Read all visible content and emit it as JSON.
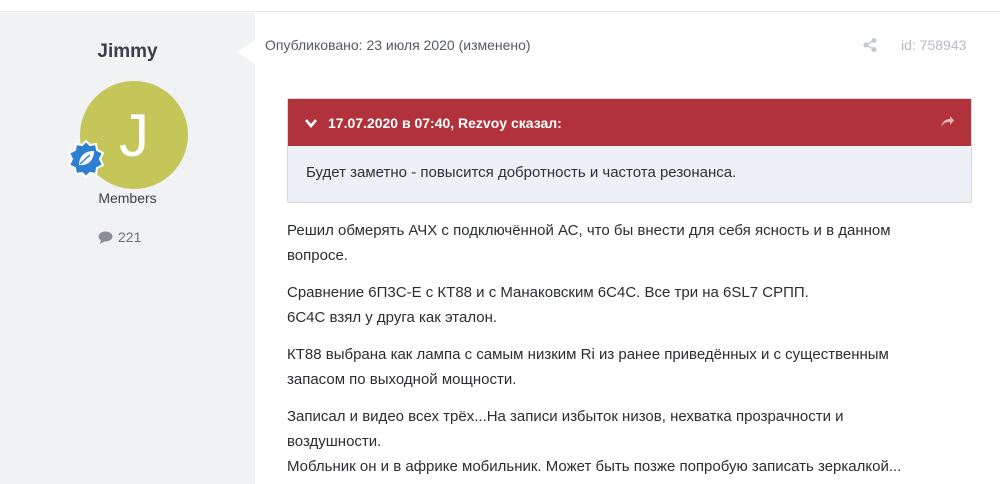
{
  "author": {
    "name": "Jimmy",
    "avatar_letter": "J",
    "avatar_color": "#c4c65a",
    "group": "Members",
    "post_count": "221",
    "badge_icon": "leaf-badge-icon",
    "count_icon": "comment-icon"
  },
  "post": {
    "published": "Опубликовано: 23 июля 2020 (изменено)",
    "id_label": "id: 758943",
    "share_icon": "share-icon"
  },
  "quote": {
    "header": "17.07.2020 в 07:40, Rezvoy сказал:",
    "body": "Будет заметно - повысится добротность и  частота резонанса.",
    "header_color": "#b1323a"
  },
  "content": {
    "paragraphs": [
      [
        "Решил обмерять АЧХ с подключённой АС, что бы внести для себя ясность и в данном",
        "вопросе."
      ],
      [
        "Сравнение 6П3С-Е с КТ88 и с Манаковским 6С4С. Все три на 6SL7 СРПП.",
        "6С4С взял у друга как эталон."
      ],
      [
        "КТ88 выбрана как лампа с самым низким Ri из ранее приведённых и с существенным",
        "запасом по выходной мощности."
      ],
      [
        "Записал и видео всех трёх...На записи избыток низов, нехватка прозрачности и",
        "воздушности.",
        "Мобльник он и в африке мобильник. Может быть позже попробую записать зеркалкой..."
      ]
    ]
  }
}
